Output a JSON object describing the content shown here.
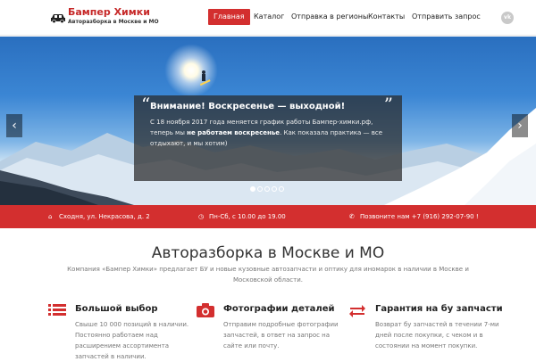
{
  "logo": {
    "title": "Бампер Химки",
    "subtitle": "Авторазборка в Москве и МО"
  },
  "nav": {
    "items": [
      {
        "label": "Главная",
        "active": true
      },
      {
        "label": "Каталог",
        "active": false
      },
      {
        "label": "Отправка в регионы",
        "active": false
      },
      {
        "label": "Контакты",
        "active": false
      },
      {
        "label": "Отправить запрос",
        "active": false
      }
    ],
    "social_icon": "vk-icon",
    "social_label": "vk"
  },
  "hero": {
    "notice_title": "Внимание! Воскресенье — выходной!",
    "notice_text_1": "С 18 ноября 2017 года меняется график работы Бампер-химки.рф, теперь мы ",
    "notice_text_bold": "не работаем воскресенье",
    "notice_text_2": ". Как показала практика — все отдыхают, и мы хотим)",
    "slides_count": 5,
    "active_slide": 1,
    "arrow_left": "‹",
    "arrow_right": "›"
  },
  "infobar": {
    "address": "Сходня, ул. Некрасова, д. 2",
    "hours": "Пн-Сб, с 10.00 до 19.00",
    "phone": "Позвоните нам +7 (916) 292-07-90 !",
    "address_icon": "home-icon",
    "hours_icon": "clock-icon",
    "phone_icon": "phone-icon"
  },
  "main": {
    "title": "Авторазборка в Москве и МО",
    "description": "Компания «Бампер Химки» предлагает БУ и новые кузовные автозапчасти и оптику для иномарок в наличии в Москве и Московской области."
  },
  "features": [
    {
      "icon": "list-icon",
      "title": "Большой выбор",
      "text": "Свыше 10 000 позиций в наличии. Постоянно работаем над расширением ассортимента запчастей в наличии."
    },
    {
      "icon": "camera-icon",
      "title": "Фотографии деталей",
      "text": "Отправим подробные фотографии запчастей, в ответ на запрос на сайте или почту."
    },
    {
      "icon": "exchange-icon",
      "title": "Гарантия на бу запчасти",
      "text": "Возврат бу запчастей в течении 7-ми дней после покупки, с чеком и в состоянии на момент покупки."
    }
  ],
  "colors": {
    "accent": "#d32f2f",
    "text": "#333333",
    "muted": "#777777"
  }
}
